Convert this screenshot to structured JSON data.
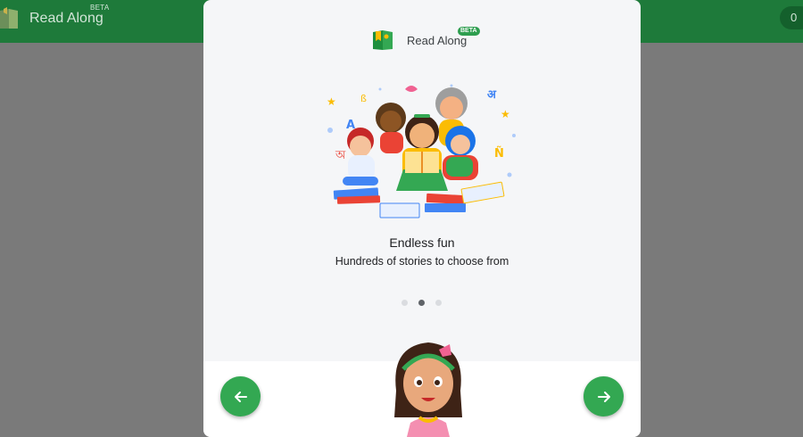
{
  "app": {
    "brand_name": "Read Along",
    "beta_label": "BETA",
    "header_pill_text": "0"
  },
  "dialog": {
    "brand_name": "Read Along",
    "beta_label": "BETA",
    "slide": {
      "title": "Endless fun",
      "subtitle": "Hundreds of stories to choose from"
    },
    "pagination": {
      "count": 3,
      "active": 1
    },
    "prev_button": {
      "icon": "arrow-left-icon"
    },
    "next_button": {
      "icon": "arrow-right-icon"
    }
  },
  "colors": {
    "app_bar": "#1e7a3a",
    "primary_green": "#33a852",
    "overlay": "#7a7a7a",
    "dialog_bg": "#f5f6f8"
  }
}
